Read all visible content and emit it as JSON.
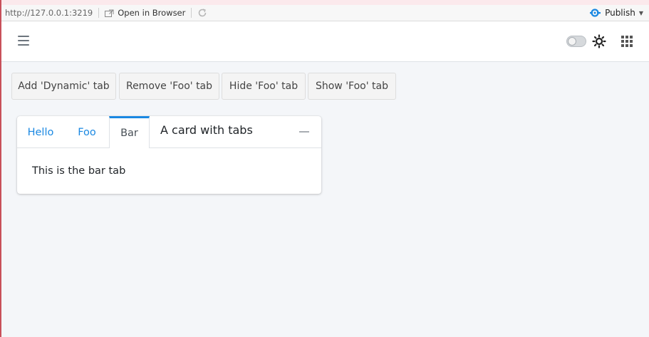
{
  "viewer": {
    "url": "http://127.0.0.1:3219",
    "open_in_browser": "Open in Browser",
    "publish": "Publish",
    "icons": [
      "open-in-browser-icon",
      "refresh-icon",
      "publish-icon",
      "caret-down-icon"
    ]
  },
  "navbar": {
    "icons": [
      "hamburger-icon",
      "dark-mode-toggle",
      "sun-icon",
      "apps-grid-icon"
    ],
    "dark_mode_on": false
  },
  "actions": [
    {
      "label": "Add 'Dynamic' tab"
    },
    {
      "label": "Remove 'Foo' tab"
    },
    {
      "label": "Hide 'Foo' tab"
    },
    {
      "label": "Show 'Foo' tab"
    }
  ],
  "card": {
    "tabs": [
      {
        "label": "Hello",
        "active": false
      },
      {
        "label": "Foo",
        "active": false
      },
      {
        "label": "Bar",
        "active": true
      }
    ],
    "title": "A card with tabs",
    "body": "This is the bar tab"
  },
  "colors": {
    "accent": "#1a88e2",
    "page_bg": "#f4f6f9",
    "publish_icon": "#1a88e2"
  }
}
